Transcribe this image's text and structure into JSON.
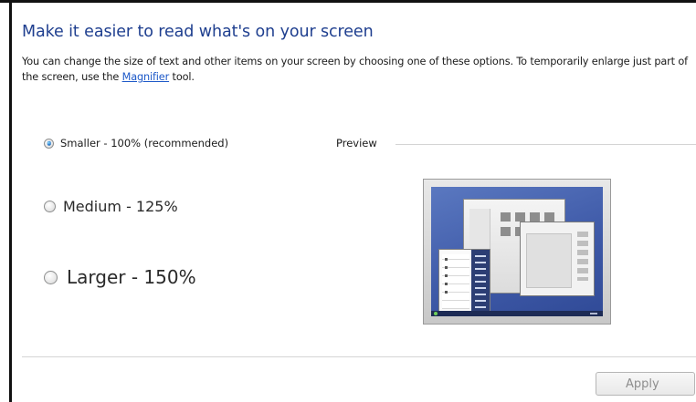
{
  "header": {
    "title": "Make it easier to read what's on your screen",
    "description_before_link": "You can change the size of text and other items on your screen by choosing one of these options. To temporarily enlarge just part of the screen, use the ",
    "magnifier_link": "Magnifier",
    "description_after_link": " tool."
  },
  "options": [
    {
      "label": "Smaller - 100% (recommended)",
      "selected": true
    },
    {
      "label": "Medium - 125%",
      "selected": false
    },
    {
      "label": "Larger - 150%",
      "selected": false
    }
  ],
  "preview": {
    "label": "Preview"
  },
  "footer": {
    "apply_label": "Apply",
    "apply_enabled": false
  },
  "colors": {
    "title": "#1f3f8f",
    "link": "#1c58c8",
    "desktop_background": "#3f5aa8"
  }
}
